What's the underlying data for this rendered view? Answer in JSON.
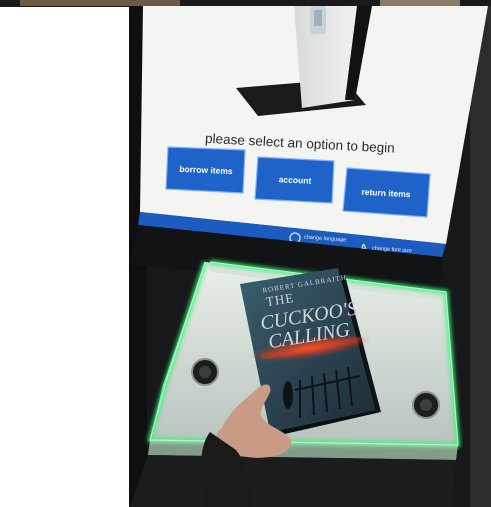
{
  "kiosk": {
    "prompt": "please select an option to begin",
    "buttons": {
      "borrow": "borrow items",
      "account": "account",
      "return": "return items"
    },
    "footer": {
      "change_language": "change language",
      "change_font_size": "change font size"
    }
  },
  "book": {
    "author": "ROBERT GALBRAITH",
    "title_line1": "THE",
    "title_line2": "CUCKOO'S",
    "title_line3": "CALLING"
  },
  "colors": {
    "screen_bg": "#f4f4f2",
    "button_blue": "#1f63c9",
    "footer_blue": "#1c5bbf",
    "glow_green": "#3ef07a",
    "scan_red": "#ff3a1a"
  }
}
